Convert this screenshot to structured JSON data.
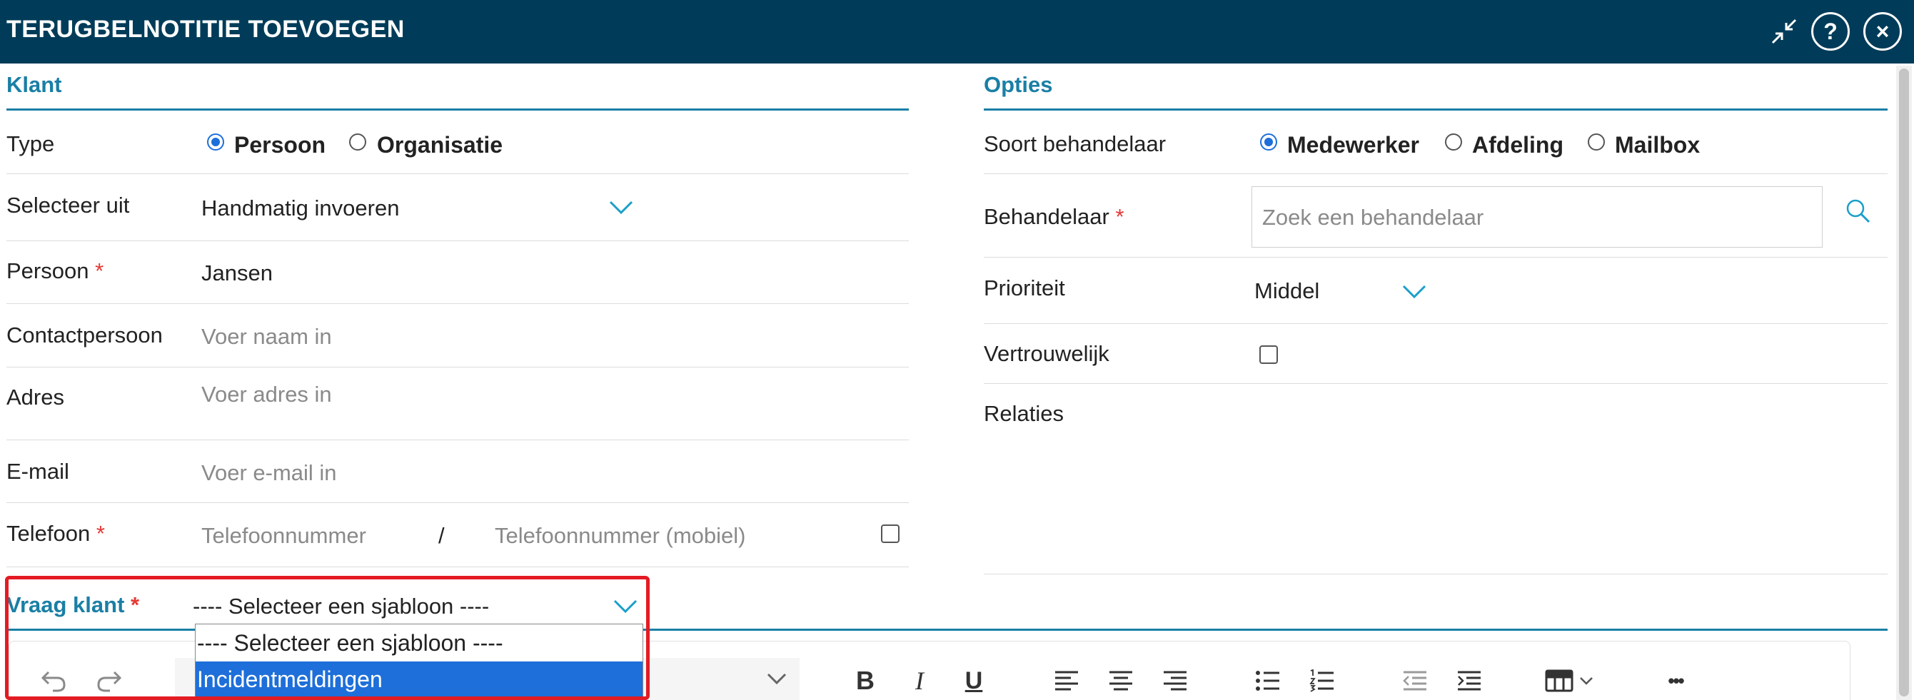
{
  "window": {
    "title": "TERUGBELNOTITIE TOEVOEGEN",
    "icons": [
      "collapse-icon",
      "help-icon",
      "close-icon"
    ],
    "header_color": "#003c59"
  },
  "klant": {
    "heading": "Klant",
    "type": {
      "label": "Type",
      "options": [
        "Persoon",
        "Organisatie"
      ],
      "selected": "Persoon"
    },
    "selecteer_uit": {
      "label": "Selecteer uit",
      "value": "Handmatig invoeren"
    },
    "persoon": {
      "label": "Persoon",
      "required_mark": "*",
      "value": "Jansen"
    },
    "contactpersoon": {
      "label": "Contactpersoon",
      "placeholder": "Voer naam in"
    },
    "adres": {
      "label": "Adres",
      "placeholder": "Voer adres in"
    },
    "email": {
      "label": "E-mail",
      "placeholder": "Voer e-mail in"
    },
    "telefoon": {
      "label": "Telefoon",
      "required_mark": "*",
      "placeholder": "Telefoonnummer",
      "separator": "/",
      "placeholder_mobile": "Telefoonnummer (mobiel)"
    }
  },
  "opties": {
    "heading": "Opties",
    "soort_behandelaar": {
      "label": "Soort behandelaar",
      "options": [
        "Medewerker",
        "Afdeling",
        "Mailbox"
      ],
      "selected": "Medewerker"
    },
    "behandelaar": {
      "label": "Behandelaar",
      "required_mark": "*",
      "placeholder": "Zoek een behandelaar"
    },
    "prioriteit": {
      "label": "Prioriteit",
      "value": "Middel"
    },
    "vertrouwelijk": {
      "label": "Vertrouwelijk",
      "checked": false
    },
    "relaties": {
      "label": "Relaties"
    }
  },
  "vraag_klant": {
    "label": "Vraag klant",
    "required_mark": "*",
    "value": "---- Selecteer een sjabloon ----",
    "options": [
      "---- Selecteer een sjabloon ----",
      "Incidentmeldingen"
    ],
    "highlighted_option": "Incidentmeldingen"
  },
  "editor_toolbar": {
    "tools": [
      "undo-icon",
      "redo-icon",
      "font-select",
      "bold-icon",
      "italic-icon",
      "underline-icon",
      "align-left-icon",
      "align-center-icon",
      "align-right-icon",
      "bullet-list-icon",
      "numbered-list-icon",
      "outdent-icon",
      "indent-icon",
      "table-icon",
      "more-icon"
    ],
    "bold_glyph": "B",
    "italic_glyph": "I",
    "underline_glyph": "U",
    "more_glyph": "•••"
  },
  "colors": {
    "accent": "#1a7fa5",
    "required": "#e53935",
    "selection": "#1e6fd9",
    "highlight_border": "#e31b23"
  }
}
